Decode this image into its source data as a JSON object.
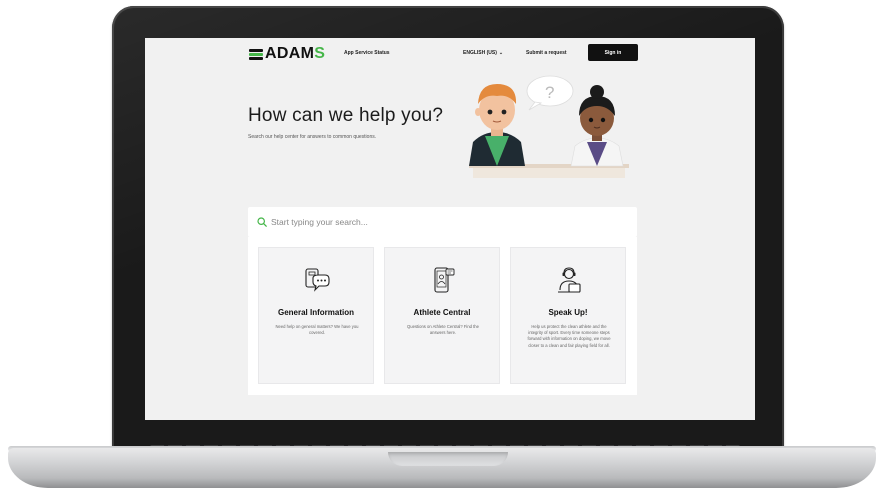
{
  "header": {
    "logo_text": "ADAM",
    "logo_accent": "S",
    "nav_status": "App Service Status",
    "nav_language": "ENGLISH (US)",
    "nav_submit": "Submit a request",
    "signin_label": "Sign in"
  },
  "hero": {
    "title": "How can we help you?",
    "subtitle": "Search our help center for answers to common questions."
  },
  "search": {
    "placeholder": "Start typing your search..."
  },
  "cards": [
    {
      "title": "General Information",
      "description": "Need help on general matters? We have you covered.",
      "icon": "chat-support-icon"
    },
    {
      "title": "Athlete Central",
      "description": "Questions on Athlete Central? Find the answers here.",
      "icon": "mobile-app-icon"
    },
    {
      "title": "Speak Up!",
      "description": "Help us protect the clean athlete and the integrity of sport. Every time someone steps forward with information on doping, we move closer to a clean and fair playing field for all.",
      "icon": "whistleblower-icon"
    }
  ],
  "colors": {
    "brand_green": "#45b649",
    "header_button": "#111111",
    "page_background": "#f1f1f1"
  }
}
